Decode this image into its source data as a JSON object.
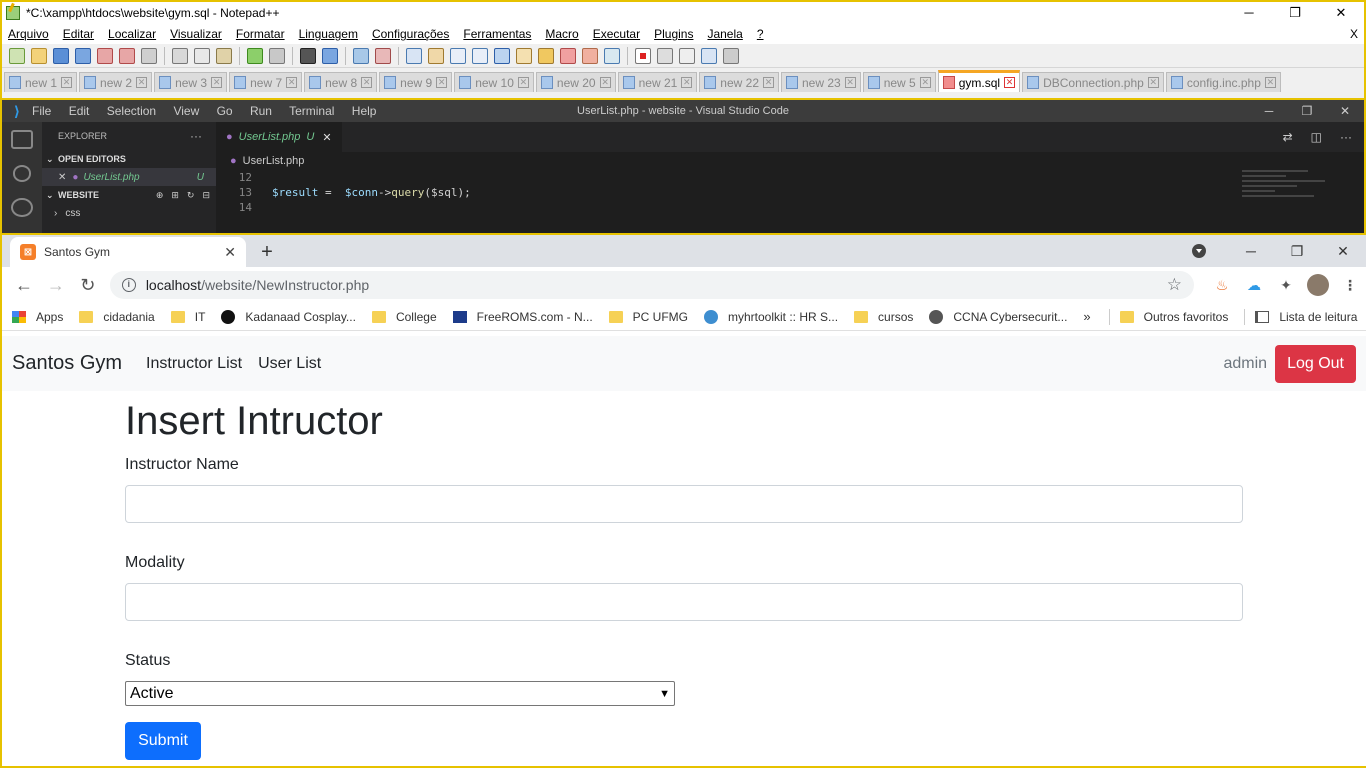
{
  "notepad": {
    "title": "*C:\\xampp\\htdocs\\website\\gym.sql - Notepad++",
    "menu": [
      "Arquivo",
      "Editar",
      "Localizar",
      "Visualizar",
      "Formatar",
      "Linguagem",
      "Configurações",
      "Ferramentas",
      "Macro",
      "Executar",
      "Plugins",
      "Janela",
      "?"
    ],
    "close_doc": "X",
    "tabs": [
      "new 1",
      "new 2",
      "new 3",
      "new 7",
      "new 8",
      "new 9",
      "new 10",
      "new 20",
      "new 21",
      "new 22",
      "new 23",
      "new 5",
      "gym.sql",
      "DBConnection.php",
      "config.inc.php"
    ],
    "active_tab": "gym.sql"
  },
  "vscode": {
    "menu": [
      "File",
      "Edit",
      "Selection",
      "View",
      "Go",
      "Run",
      "Terminal",
      "Help"
    ],
    "title": "UserList.php - website - Visual Studio Code",
    "explorer_title": "EXPLORER",
    "open_editors": "OPEN EDITORS",
    "open_file": "UserList.php",
    "open_file_status": "U",
    "workspace": "WEBSITE",
    "folder": "css",
    "tab_name": "UserList.php",
    "tab_status": "U",
    "breadcrumb": "UserList.php",
    "lines": [
      {
        "no": "12",
        "code": ""
      },
      {
        "no": "13",
        "var1": "$result",
        "op": " =  ",
        "var2": "$conn",
        "arrow": "->",
        "fn": "query",
        "arg": "($sql);"
      },
      {
        "no": "14",
        "code": ""
      }
    ]
  },
  "browser": {
    "tab_title": "Santos Gym",
    "url_host": "localhost",
    "url_path": "/website/NewInstructor.php",
    "bookmarks": [
      "Apps",
      "cidadania",
      "IT",
      "Kadanaad Cosplay...",
      "College",
      "FreeROMS.com - N...",
      "PC UFMG",
      "myhrtoolkit :: HR S...",
      "cursos",
      "CCNA Cybersecurit..."
    ],
    "other_bookmarks": "Outros favoritos",
    "reading_list": "Lista de leitura"
  },
  "site": {
    "brand": "Santos Gym",
    "nav": [
      "Instructor List",
      "User List"
    ],
    "user": "admin",
    "logout": "Log Out",
    "heading": "Insert Intructor",
    "label_name": "Instructor Name",
    "label_modality": "Modality",
    "label_status": "Status",
    "status_value": "Active",
    "submit": "Submit"
  }
}
